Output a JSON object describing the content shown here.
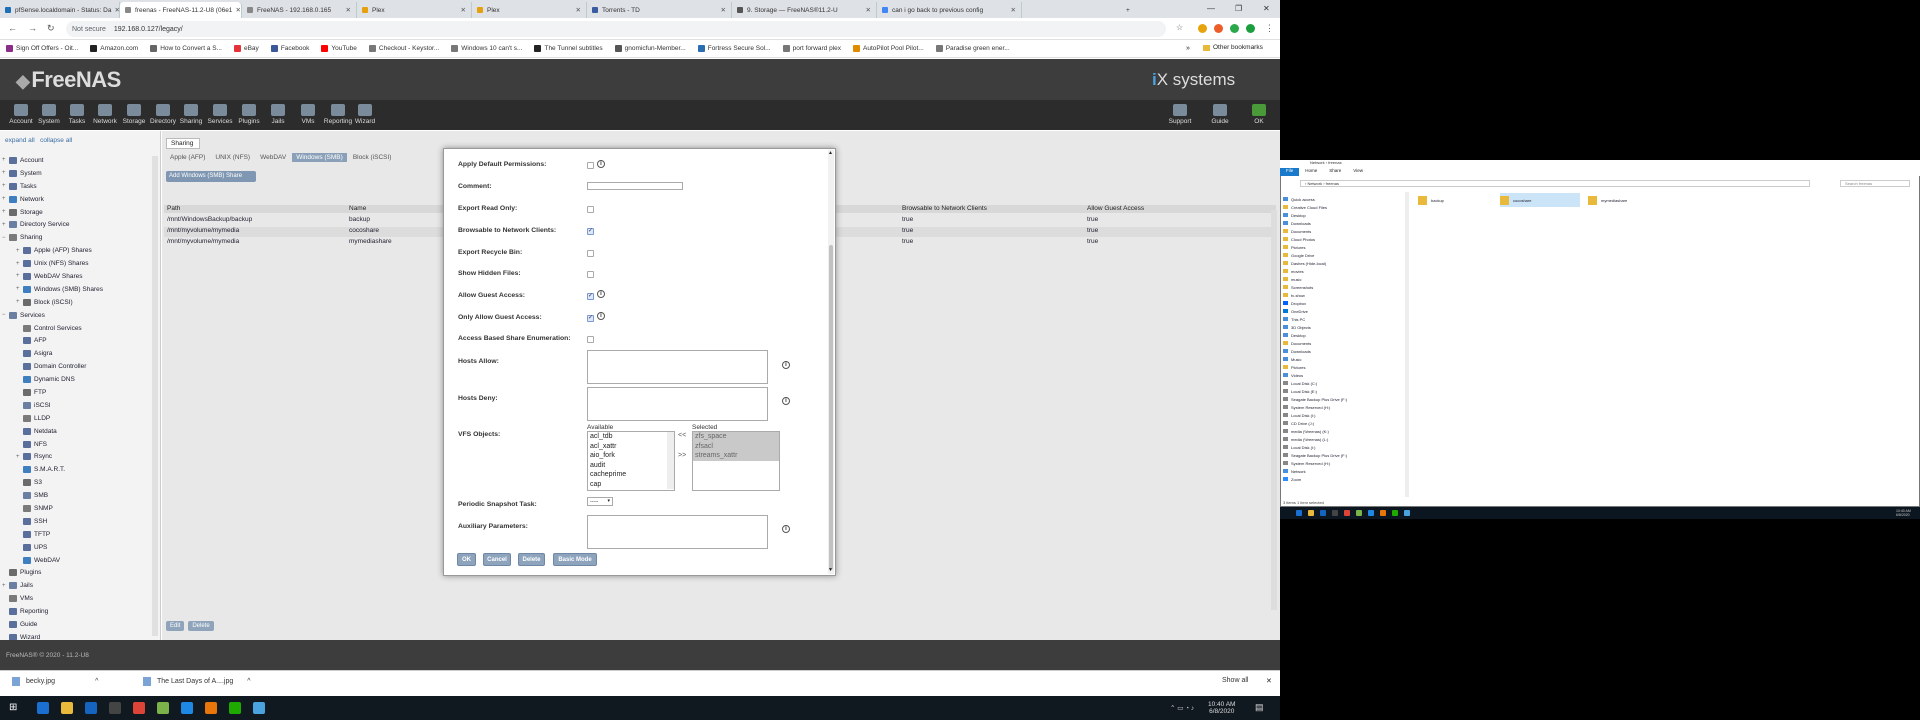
{
  "browser": {
    "tabs": [
      {
        "title": "pfSense.localdomain - Status: Da",
        "color": "#1d6fb8"
      },
      {
        "title": "freenas - FreeNAS-11.2-U8 (06e1",
        "color": "#888888"
      },
      {
        "title": "FreeNAS - 192.168.0.165",
        "color": "#888888"
      },
      {
        "title": "Plex",
        "color": "#e5a00d"
      },
      {
        "title": "Plex",
        "color": "#e5a00d"
      },
      {
        "title": "Torrents - TD",
        "color": "#3a5ba0"
      },
      {
        "title": "9. Storage — FreeNAS®11.2-U",
        "color": "#555555"
      },
      {
        "title": "can i go back to previous config",
        "color": "#4285f4"
      }
    ],
    "new_tab": "+",
    "not_secure": "Not secure",
    "url": "192.168.0.127/legacy/",
    "bookmarks": [
      {
        "label": "Sign Off Offers - Oit...",
        "color": "#8a2c8a"
      },
      {
        "label": "Amazon.com",
        "color": "#222222"
      },
      {
        "label": "How to Convert a S...",
        "color": "#666666"
      },
      {
        "label": "eBay",
        "color": "#e53238"
      },
      {
        "label": "Facebook",
        "color": "#3b5998"
      },
      {
        "label": "YouTube",
        "color": "#ff0000"
      },
      {
        "label": "Checkout - Keystor...",
        "color": "#777777"
      },
      {
        "label": "Windows 10 can't s...",
        "color": "#777777"
      },
      {
        "label": "The Tunnel subtitles",
        "color": "#222222"
      },
      {
        "label": "gnomicfun-Member...",
        "color": "#555555"
      },
      {
        "label": "Fortress Secure Sol...",
        "color": "#2a6db0"
      },
      {
        "label": "port forward plex",
        "color": "#777777"
      },
      {
        "label": "AutoPilot Pool Pilot...",
        "color": "#e08a00"
      },
      {
        "label": "Paradise green ener...",
        "color": "#777777"
      }
    ],
    "other_bookmarks": "Other bookmarks"
  },
  "freenas": {
    "logo": "FreeNAS",
    "vendor_prefix": "i",
    "vendor": "X systems",
    "toolbar": [
      "Account",
      "System",
      "Tasks",
      "Network",
      "Storage",
      "Directory",
      "Sharing",
      "Services",
      "Plugins",
      "Jails",
      "VMs",
      "Reporting",
      "Wizard"
    ],
    "toolbar_right": [
      "Support",
      "Guide",
      "OK"
    ],
    "expand_all": "expand all",
    "collapse_all": "collapse all",
    "tree": [
      {
        "label": "Account",
        "level": 0,
        "pm": "+"
      },
      {
        "label": "System",
        "level": 0,
        "pm": "+"
      },
      {
        "label": "Tasks",
        "level": 0,
        "pm": "+"
      },
      {
        "label": "Network",
        "level": 0,
        "pm": "+"
      },
      {
        "label": "Storage",
        "level": 0,
        "pm": "+"
      },
      {
        "label": "Directory Service",
        "level": 0,
        "pm": "+"
      },
      {
        "label": "Sharing",
        "level": 0,
        "pm": "−"
      },
      {
        "label": "Apple (AFP) Shares",
        "level": 1,
        "pm": "+"
      },
      {
        "label": "Unix (NFS) Shares",
        "level": 1,
        "pm": "+"
      },
      {
        "label": "WebDAV Shares",
        "level": 1,
        "pm": "+"
      },
      {
        "label": "Windows (SMB) Shares",
        "level": 1,
        "pm": "+"
      },
      {
        "label": "Block (iSCSI)",
        "level": 1,
        "pm": "+"
      },
      {
        "label": "Services",
        "level": 0,
        "pm": "−"
      },
      {
        "label": "Control Services",
        "level": 1,
        "pm": ""
      },
      {
        "label": "AFP",
        "level": 1,
        "pm": ""
      },
      {
        "label": "Asigra",
        "level": 1,
        "pm": ""
      },
      {
        "label": "Domain Controller",
        "level": 1,
        "pm": ""
      },
      {
        "label": "Dynamic DNS",
        "level": 1,
        "pm": ""
      },
      {
        "label": "FTP",
        "level": 1,
        "pm": ""
      },
      {
        "label": "iSCSI",
        "level": 1,
        "pm": ""
      },
      {
        "label": "LLDP",
        "level": 1,
        "pm": ""
      },
      {
        "label": "Netdata",
        "level": 1,
        "pm": ""
      },
      {
        "label": "NFS",
        "level": 1,
        "pm": ""
      },
      {
        "label": "Rsync",
        "level": 1,
        "pm": "+"
      },
      {
        "label": "S.M.A.R.T.",
        "level": 1,
        "pm": ""
      },
      {
        "label": "S3",
        "level": 1,
        "pm": ""
      },
      {
        "label": "SMB",
        "level": 1,
        "pm": ""
      },
      {
        "label": "SNMP",
        "level": 1,
        "pm": ""
      },
      {
        "label": "SSH",
        "level": 1,
        "pm": ""
      },
      {
        "label": "TFTP",
        "level": 1,
        "pm": ""
      },
      {
        "label": "UPS",
        "level": 1,
        "pm": ""
      },
      {
        "label": "WebDAV",
        "level": 1,
        "pm": ""
      },
      {
        "label": "Plugins",
        "level": 0,
        "pm": ""
      },
      {
        "label": "Jails",
        "level": 0,
        "pm": "+"
      },
      {
        "label": "VMs",
        "level": 0,
        "pm": ""
      },
      {
        "label": "Reporting",
        "level": 0,
        "pm": ""
      },
      {
        "label": "Guide",
        "level": 0,
        "pm": ""
      },
      {
        "label": "Wizard",
        "level": 0,
        "pm": ""
      }
    ],
    "sharing_tab": "Sharing",
    "subtabs": [
      "Apple (AFP)",
      "UNIX (NFS)",
      "WebDAV",
      "Windows (SMB)",
      "Block (iSCSI)"
    ],
    "add_button": "Add Windows (SMB) Share",
    "table": {
      "headers": [
        "Path",
        "Name",
        "Browsable to Network Clients",
        "Allow Guest Access"
      ],
      "rows": [
        [
          "/mnt/WindowsBackup/backup",
          "backup",
          "true",
          "true"
        ],
        [
          "/mnt/myvolume/mymedia",
          "cocoshare",
          "true",
          "true"
        ],
        [
          "/mnt/myvolume/mymedia",
          "mymediashare",
          "true",
          "true"
        ]
      ]
    },
    "edit_buttons": [
      "Edit",
      "Delete"
    ],
    "footer": "FreeNAS® © 2020",
    "footer_version": " - 11.2-U8"
  },
  "modal": {
    "fields": {
      "apply_default_permissions": "Apply Default Permissions:",
      "comment": "Comment:",
      "export_read_only": "Export Read Only:",
      "browsable": "Browsable to Network Clients:",
      "export_recycle_bin": "Export Recycle Bin:",
      "show_hidden_files": "Show Hidden Files:",
      "allow_guest_access": "Allow Guest Access:",
      "only_allow_guest_access": "Only Allow Guest Access:",
      "access_based_enum": "Access Based Share Enumeration:",
      "hosts_allow": "Hosts Allow:",
      "hosts_deny": "Hosts Deny:",
      "vfs_objects": "VFS Objects:",
      "periodic_snapshot": "Periodic Snapshot Task:",
      "auxiliary_parameters": "Auxiliary Parameters:"
    },
    "checks": {
      "apply_default_permissions": false,
      "export_read_only": false,
      "browsable": true,
      "export_recycle_bin": false,
      "show_hidden_files": false,
      "allow_guest_access": true,
      "only_allow_guest_access": true,
      "access_based_enum": false
    },
    "info_glyph": "i",
    "available_label": "Available",
    "selected_label": "Selected",
    "available": [
      "acl_tdb",
      "acl_xattr",
      "aio_fork",
      "audit",
      "cacheprime",
      "cap"
    ],
    "selected": [
      "zfs_space",
      "zfsacl",
      "streams_xattr"
    ],
    "move_left": "<<",
    "move_right": ">>",
    "snapshot_value": "-----",
    "buttons": [
      "OK",
      "Cancel",
      "Delete",
      "Basic Mode"
    ]
  },
  "downloads": {
    "items": [
      "becky.jpg",
      "The Last Days of A....jpg"
    ],
    "show_all": "Show all"
  },
  "taskbar": {
    "time": "10:40 AM",
    "date": "6/8/2020",
    "icons": [
      "#1a6fd0",
      "#e8b93a",
      "#1565c0",
      "#444444",
      "#db4437",
      "#7bb34a",
      "#1e88e5",
      "#e8760a",
      "#1faa00",
      "#4aa3df"
    ]
  },
  "explorer": {
    "title": "Network › freenas",
    "ribbon": [
      "File",
      "Home",
      "Share",
      "View"
    ],
    "address": "›  Network  ›  freenas",
    "search": "Search freenas",
    "nav": [
      {
        "label": "Quick access",
        "color": "#4a90d9"
      },
      {
        "label": "Creative Cloud Files",
        "color": "#e8b93a"
      },
      {
        "label": "Desktop",
        "color": "#4a90d9"
      },
      {
        "label": "Downloads",
        "color": "#4a90d9"
      },
      {
        "label": "Documents",
        "color": "#e8b93a"
      },
      {
        "label": "Cloud Photos",
        "color": "#e8b93a"
      },
      {
        "label": "Pictures",
        "color": "#e8b93a"
      },
      {
        "label": "Google Drive",
        "color": "#e8b93a"
      },
      {
        "label": "Dashes (Hide-local)",
        "color": "#e8b93a"
      },
      {
        "label": "movies",
        "color": "#e8b93a"
      },
      {
        "label": "music",
        "color": "#e8b93a"
      },
      {
        "label": "Screenshots",
        "color": "#e8b93a"
      },
      {
        "label": "tv-show",
        "color": "#e8b93a"
      },
      {
        "label": "Dropbox",
        "color": "#0061ff"
      },
      {
        "label": "OneDrive",
        "color": "#0078d4"
      },
      {
        "label": "This PC",
        "color": "#4a90d9"
      },
      {
        "label": "3D Objects",
        "color": "#4a90d9"
      },
      {
        "label": "Desktop",
        "color": "#4a90d9"
      },
      {
        "label": "Documents",
        "color": "#e8b93a"
      },
      {
        "label": "Downloads",
        "color": "#4a90d9"
      },
      {
        "label": "Music",
        "color": "#4a90d9"
      },
      {
        "label": "Pictures",
        "color": "#e8b93a"
      },
      {
        "label": "Videos",
        "color": "#4a90d9"
      },
      {
        "label": "Local Disk (C:)",
        "color": "#888888"
      },
      {
        "label": "Local Disk (E:)",
        "color": "#888888"
      },
      {
        "label": "Seagate Backup Plus Drive (F:)",
        "color": "#888888"
      },
      {
        "label": "System Reserved (H:)",
        "color": "#888888"
      },
      {
        "label": "Local Disk (I:)",
        "color": "#888888"
      },
      {
        "label": "CD Drive (J:)",
        "color": "#888888"
      },
      {
        "label": "media (\\\\freenas) (K:)",
        "color": "#888888"
      },
      {
        "label": "media (\\\\freenas) (L:)",
        "color": "#888888"
      },
      {
        "label": "Local Disk (I:)",
        "color": "#888888"
      },
      {
        "label": "Seagate Backup Plus Drive (F:)",
        "color": "#888888"
      },
      {
        "label": "System Reserved (H:)",
        "color": "#888888"
      },
      {
        "label": "Network",
        "color": "#4a90d9"
      },
      {
        "label": "Zoom",
        "color": "#2d8cff"
      }
    ],
    "files": [
      "backup",
      "cocoshare",
      "mymediashare"
    ],
    "status": "3 items   1 item selected"
  }
}
